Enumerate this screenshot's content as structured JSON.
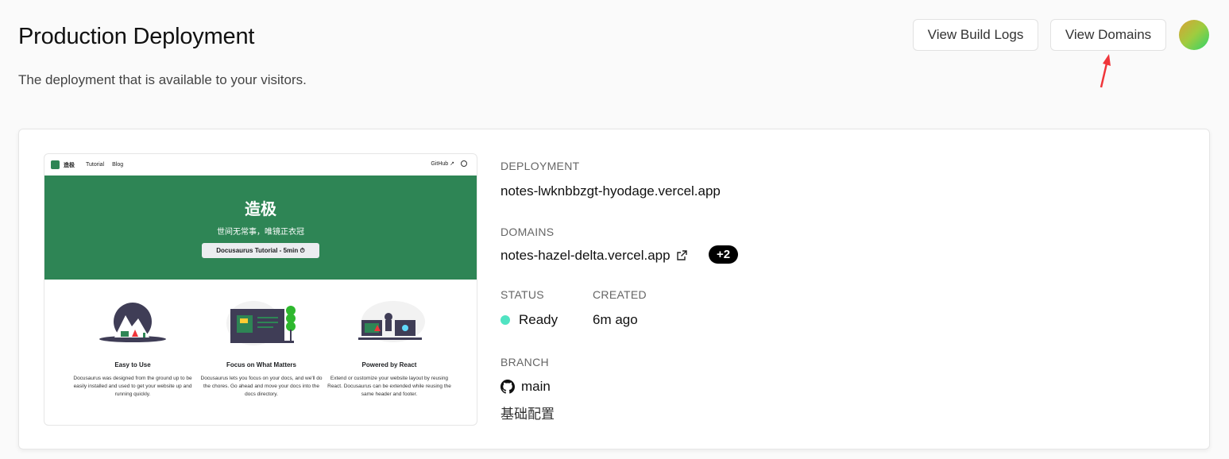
{
  "header": {
    "title": "Production Deployment",
    "subtitle": "The deployment that is available to your visitors.",
    "view_build_logs": "View Build Logs",
    "view_domains": "View Domains"
  },
  "preview": {
    "brand": "造极",
    "nav_links": [
      "Tutorial",
      "Blog"
    ],
    "github_link": "GitHub",
    "hero_title": "造极",
    "hero_subtitle": "世间无常事，唯镜正衣冠",
    "hero_button": "Docusaurus Tutorial - 5min ⏱",
    "features": [
      {
        "title": "Easy to Use",
        "description": "Docusaurus was designed from the ground up to be easily installed and used to get your website up and running quickly."
      },
      {
        "title": "Focus on What Matters",
        "description": "Docusaurus lets you focus on your docs, and we'll do the chores. Go ahead and move your docs into the docs directory."
      },
      {
        "title": "Powered by React",
        "description": "Extend or customize your website layout by reusing React. Docusaurus can be extended while reusing the same header and footer."
      }
    ]
  },
  "deployment": {
    "label": "DEPLOYMENT",
    "url": "notes-lwknbbzgt-hyodage.vercel.app"
  },
  "domains": {
    "label": "DOMAINS",
    "primary": "notes-hazel-delta.vercel.app",
    "more_count": "+2"
  },
  "status": {
    "label": "STATUS",
    "value": "Ready",
    "color": "#50e3c2"
  },
  "created": {
    "label": "CREATED",
    "value": "6m ago"
  },
  "branch": {
    "label": "BRANCH",
    "name": "main",
    "commit_message": "基础配置"
  },
  "colors": {
    "hero_green": "#2e8555",
    "annotation_arrow": "#f0353a"
  }
}
